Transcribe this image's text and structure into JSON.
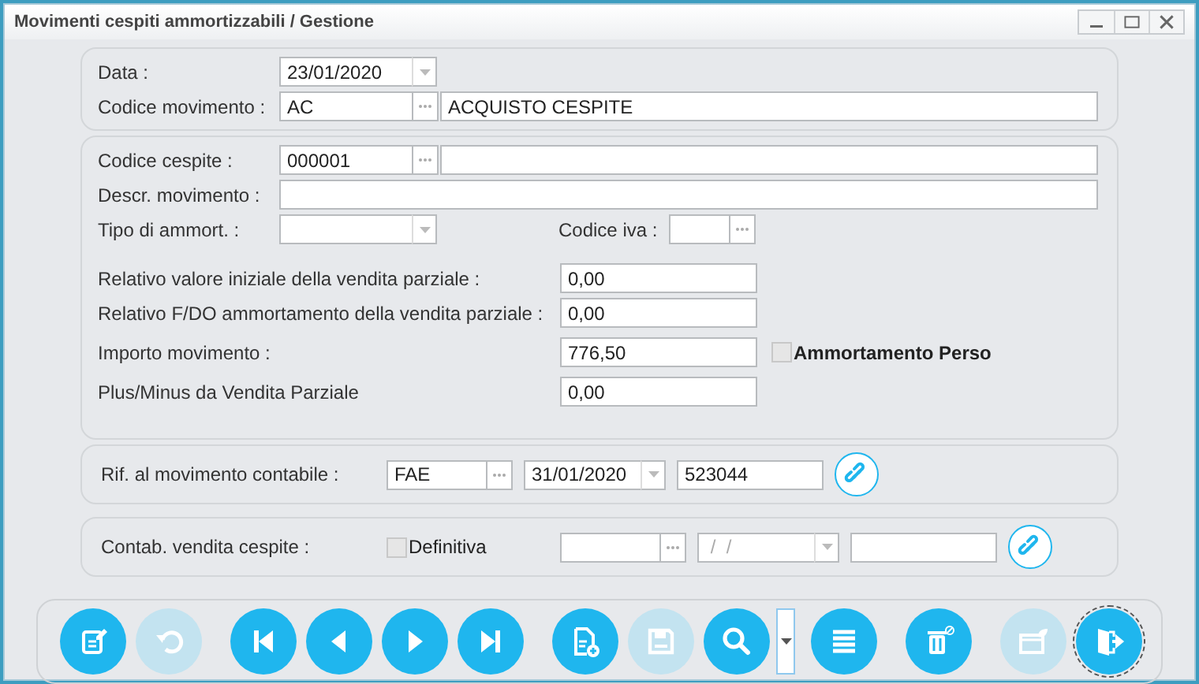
{
  "window": {
    "title": "Movimenti cespiti ammortizzabili / Gestione"
  },
  "sections": [
    {
      "rows": [
        [
          {
            "kind": "label",
            "text": "Data :"
          },
          {
            "kind": "date",
            "value": "23/01/2020"
          }
        ],
        [
          {
            "kind": "label",
            "text": "Codice movimento :"
          },
          {
            "kind": "lookup",
            "value": "AC"
          },
          {
            "kind": "fill",
            "value": "ACQUISTO CESPITE"
          }
        ]
      ]
    },
    {
      "rows": [
        [
          {
            "kind": "label",
            "text": "Codice cespite :"
          },
          {
            "kind": "lookup",
            "value": "000001"
          },
          {
            "kind": "fill"
          }
        ],
        [
          {
            "kind": "label",
            "text": "Descr. movimento :"
          },
          {
            "kind": "fill"
          }
        ],
        [
          {
            "kind": "label",
            "text": "Tipo di ammort. :"
          },
          {
            "kind": "combo"
          },
          {
            "kind": "side-label",
            "text": "Codice iva :"
          },
          {
            "kind": "short-lookup"
          }
        ]
      ],
      "amounts": [
        {
          "label": "Relativo valore iniziale della vendita parziale :",
          "value": "0,00"
        },
        {
          "label": "Relativo F/DO ammortamento della vendita parziale :",
          "value": "0,00"
        },
        {
          "label": "Importo movimento :",
          "value": "776,50",
          "checkbox": {
            "label": "Ammortamento Perso",
            "checked": false
          }
        },
        {
          "label": "Plus/Minus da Vendita Parziale",
          "value": "0,00"
        }
      ]
    },
    {
      "rows": [
        [
          {
            "kind": "ref-label",
            "text": "Rif. al movimento contabile :"
          },
          {
            "kind": "mid-lookup",
            "value": "FAE"
          },
          {
            "kind": "ref-date",
            "value": "31/01/2020"
          },
          {
            "kind": "ref-text",
            "value": "523044"
          },
          {
            "kind": "link"
          }
        ]
      ]
    },
    {
      "rows": [
        [
          {
            "kind": "ref-label",
            "text": "Contab. vendita cespite :"
          },
          {
            "kind": "checkbox",
            "label": "Definitiva",
            "checked": false
          },
          {
            "kind": "mid-lookup"
          },
          {
            "kind": "ref-date",
            "placeholder": " /  /"
          },
          {
            "kind": "ref-text"
          },
          {
            "kind": "link"
          }
        ]
      ]
    }
  ],
  "toolbar": {
    "groups": [
      [
        {
          "kind": "edit",
          "disabled": false,
          "focused": false
        },
        {
          "kind": "undo",
          "disabled": true,
          "focused": false
        }
      ],
      [
        {
          "kind": "first",
          "disabled": false,
          "focused": false
        },
        {
          "kind": "prev",
          "disabled": false,
          "focused": false
        },
        {
          "kind": "next",
          "disabled": false,
          "focused": false
        },
        {
          "kind": "last",
          "disabled": false,
          "focused": false
        }
      ],
      [
        {
          "kind": "new",
          "disabled": false,
          "focused": false
        },
        {
          "kind": "save",
          "disabled": true,
          "focused": false
        },
        {
          "kind": "search",
          "disabled": false,
          "focused": false
        },
        {
          "kind": "dropdown",
          "disabled": false,
          "focused": false
        },
        {
          "kind": "list",
          "disabled": false,
          "focused": false
        }
      ],
      [
        {
          "kind": "delete",
          "disabled": false,
          "focused": false
        }
      ],
      [
        {
          "kind": "print",
          "disabled": true,
          "focused": false
        },
        {
          "kind": "exit",
          "disabled": false,
          "focused": true
        }
      ]
    ]
  }
}
